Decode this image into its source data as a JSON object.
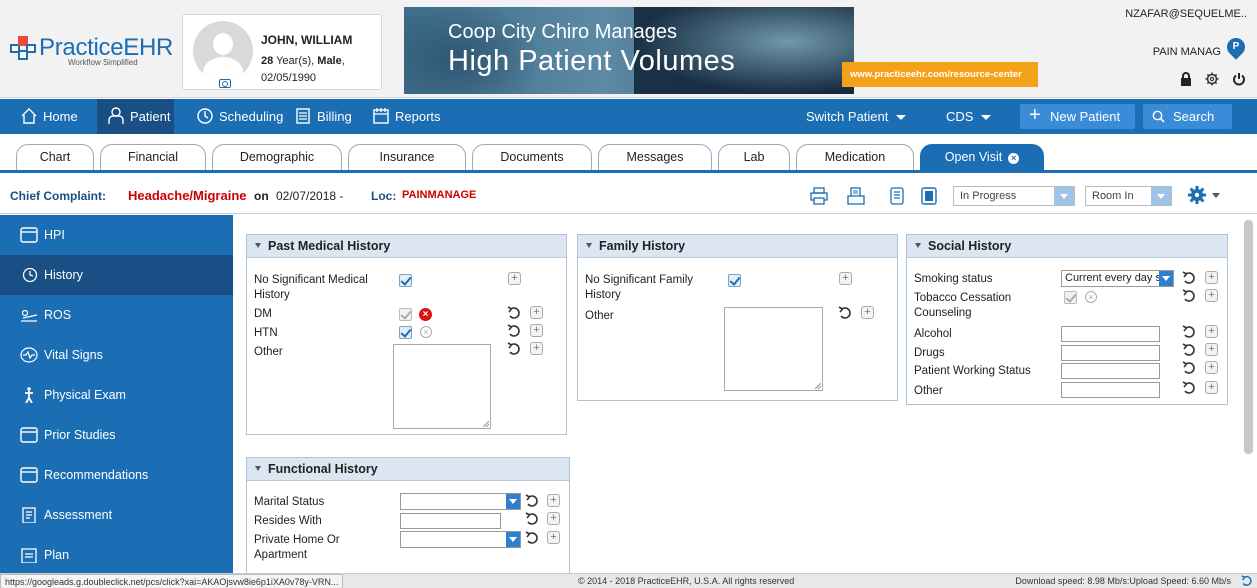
{
  "header": {
    "logo": {
      "brand_practice": "Practice",
      "brand_ehr": "EHR",
      "tagline": "Workflow Simplified"
    },
    "patient": {
      "name": "JOHN, WILLIAM",
      "age_num": "28",
      "age_rest": " Year(s), ",
      "sex": "Male",
      "sex_rest": ",",
      "dob": "02/05/1990"
    },
    "banner": {
      "line1": "Coop City Chiro Manages",
      "line2": "High Patient Volumes",
      "url": "www.practiceehr.com/resource-center"
    },
    "user": {
      "email": "NZAFAR@SEQUELME..",
      "location": "PAIN MANAG",
      "location_badge": "P"
    }
  },
  "nav": {
    "items": [
      {
        "label": "Home",
        "icon": "home-icon"
      },
      {
        "label": "Patient",
        "icon": "patient-icon"
      },
      {
        "label": "Scheduling",
        "icon": "clock-icon"
      },
      {
        "label": "Billing",
        "icon": "billing-icon"
      },
      {
        "label": "Reports",
        "icon": "calendar-icon"
      }
    ],
    "switch_patient": "Switch Patient",
    "cds": "CDS",
    "new_patient": "New Patient",
    "search": "Search"
  },
  "tabs": [
    "Chart",
    "Financial",
    "Demographic",
    "Insurance",
    "Documents",
    "Messages",
    "Lab",
    "Medication",
    "Open Visit"
  ],
  "complaint": {
    "label": "Chief Complaint:",
    "value": "Headache/Migraine",
    "on": "on",
    "date": "02/07/2018 -",
    "loc_label": "Loc:",
    "location": "PAINMANAGE",
    "status": "In Progress",
    "room": "Room In"
  },
  "sidebar": [
    {
      "label": "HPI",
      "icon": "hpi-icon"
    },
    {
      "label": "History",
      "icon": "history-icon"
    },
    {
      "label": "ROS",
      "icon": "ros-icon"
    },
    {
      "label": "Vital Signs",
      "icon": "vital-signs-icon"
    },
    {
      "label": "Physical Exam",
      "icon": "physical-exam-icon"
    },
    {
      "label": "Prior Studies",
      "icon": "prior-studies-icon"
    },
    {
      "label": "Recommendations",
      "icon": "recommendations-icon"
    },
    {
      "label": "Assessment",
      "icon": "assessment-icon"
    },
    {
      "label": "Plan",
      "icon": "plan-icon"
    }
  ],
  "pmh": {
    "title": "Past Medical History",
    "no_significant": "No Significant Medical History",
    "dm": "DM",
    "htn": "HTN",
    "other": "Other"
  },
  "family": {
    "title": "Family History",
    "no_significant": "No Significant Family History",
    "other": "Other"
  },
  "social": {
    "title": "Social History",
    "smoking": "Smoking status",
    "smoking_value": "Current every day s",
    "tobacco": "Tobacco Cessation Counseling",
    "alcohol": "Alcohol",
    "drugs": "Drugs",
    "working": "Patient Working Status",
    "other": "Other"
  },
  "functional": {
    "title": "Functional History",
    "marital": "Marital Status",
    "resides": "Resides With",
    "private_home": "Private Home Or Apartment"
  },
  "status": {
    "url": "https://googleads.g.doubleclick.net/pcs/click?xai=AKAOjsvw8ie6p1iXA0v78y-VRN...",
    "copyright": "© 2014 - 2018 PracticeEHR, U.S.A. All rights reserved",
    "speed": "Download speed: 8.98 Mb/s:Upload Speed: 6.60 Mb/s"
  }
}
